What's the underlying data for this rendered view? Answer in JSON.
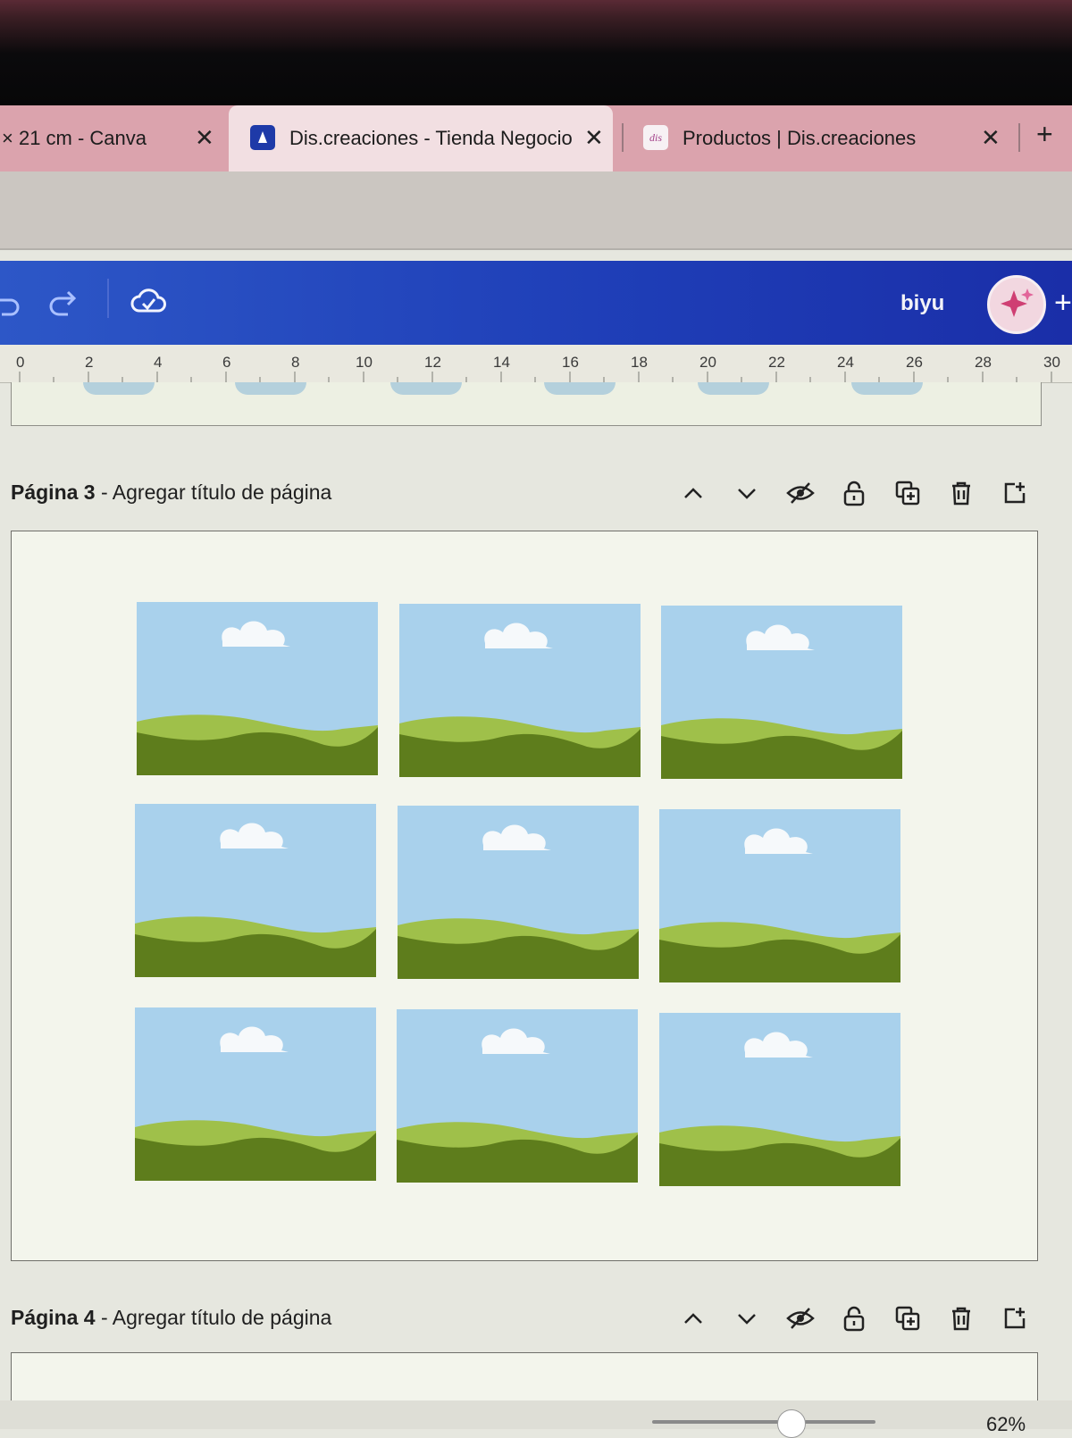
{
  "browser_tabs": [
    {
      "title": "× 21 cm - Canva",
      "close": "✕"
    },
    {
      "title": "Dis.creaciones - Tienda Negocio",
      "close": "✕"
    },
    {
      "title": "Productos | Dis.creaciones",
      "favicon_text": "dis",
      "close": "✕"
    }
  ],
  "new_tab": "+",
  "editor": {
    "user_name": "biyu",
    "plus": "+",
    "ruler_ticks": [
      "0",
      "2",
      "4",
      "6",
      "8",
      "10",
      "12",
      "14",
      "16",
      "18",
      "20",
      "22",
      "24",
      "26",
      "28",
      "30"
    ]
  },
  "pages": [
    {
      "number": "Página 3",
      "title_placeholder": "Agregar título de página",
      "separator": "-"
    },
    {
      "number": "Página 4",
      "title_placeholder": "Agregar título de página",
      "separator": "-"
    }
  ],
  "landscape_tiles": 9,
  "zoom": {
    "value": "62%",
    "percent": 62
  },
  "colors": {
    "canva_blue": "#1f3fb8",
    "sky": "#a9d1ec",
    "light_grass": "#9fc04a",
    "dark_grass": "#5e7d1c",
    "cloud": "#f6f9fb"
  },
  "icons": [
    "undo-icon",
    "redo-icon",
    "cloud-sync-icon",
    "avatar",
    "arrow-up-icon",
    "arrow-down-icon",
    "hide-icon",
    "lock-icon",
    "duplicate-icon",
    "trash-icon",
    "add-page-icon"
  ]
}
